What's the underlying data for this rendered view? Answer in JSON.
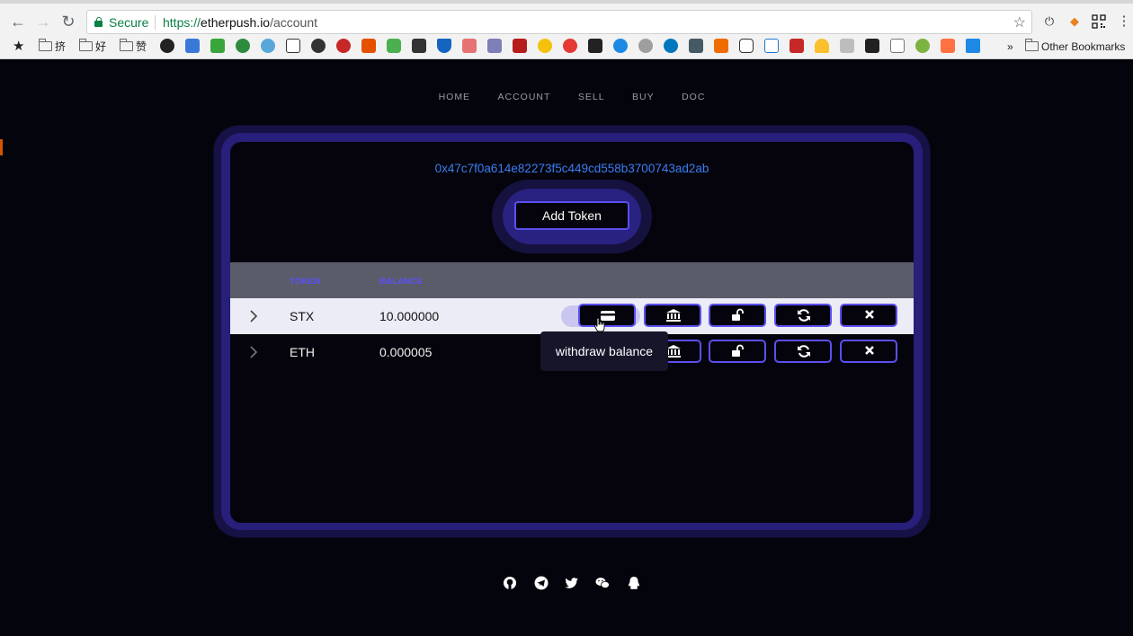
{
  "browser": {
    "secure_label": "Secure",
    "url_protocol": "https://",
    "url_host": "etherpush.io",
    "url_path": "/account",
    "bookmarks": [
      {
        "label": "挤",
        "type": "folder"
      },
      {
        "label": "好",
        "type": "folder"
      },
      {
        "label": "赞",
        "type": "folder"
      }
    ],
    "more_label": "»",
    "other_bookmarks_label": "Other Bookmarks"
  },
  "site_nav": {
    "items": [
      "HOME",
      "ACCOUNT",
      "SELL",
      "BUY",
      "DOC"
    ]
  },
  "account": {
    "address": "0x47c7f0a614e82273f5c449cd558b3700743ad2ab",
    "add_token_label": "Add Token"
  },
  "table": {
    "columns": [
      "TOKEN",
      "BALANCE"
    ],
    "rows": [
      {
        "token": "STX",
        "balance": "10.000000"
      },
      {
        "token": "ETH",
        "balance": "0.000005"
      }
    ],
    "actions": [
      "withdraw-icon",
      "bank-icon",
      "unlock-icon",
      "refresh-icon",
      "delete-icon"
    ]
  },
  "tooltip": {
    "text": "withdraw balance"
  },
  "colors": {
    "accent": "#5a4ff0",
    "address": "#3b7df0",
    "header_bg": "#5b5c6a",
    "page_bg": "#04040c"
  },
  "footer": {
    "icons": [
      "github-icon",
      "telegram-icon",
      "twitter-icon",
      "wechat-icon",
      "qq-icon"
    ]
  }
}
